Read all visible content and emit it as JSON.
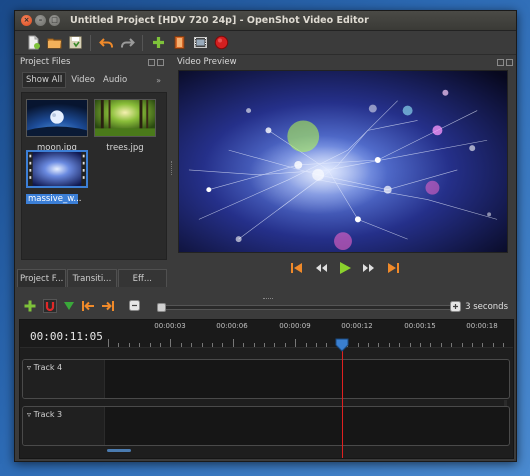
{
  "window": {
    "title": "Untitled Project [HDV 720 24p] - OpenShot Video Editor",
    "close_glyph": "×",
    "min_glyph": "–",
    "max_glyph": "□"
  },
  "toolbar": {
    "buttons": [
      "new-project",
      "open-project",
      "save-project",
      "undo",
      "redo",
      "import-files",
      "choose-profile",
      "fullscreen",
      "export-video"
    ]
  },
  "project_files": {
    "title": "Project Files",
    "filters": [
      "Show All",
      "Video",
      "Audio"
    ],
    "more_glyph": "»",
    "files": [
      {
        "name": "moon.jpg",
        "selected": false
      },
      {
        "name": "trees.jpg",
        "selected": false
      },
      {
        "name": "massive_w...",
        "selected": true
      }
    ],
    "bottom_tabs": [
      "Project F...",
      "Transiti...",
      "Eff..."
    ]
  },
  "video_preview": {
    "title": "Video Preview"
  },
  "timeline": {
    "zoom_label": "3 seconds",
    "timecode": "00:00:11:05",
    "ruler_labels": [
      "00:00:03",
      "00:00:06",
      "00:00:09",
      "00:00:12",
      "00:00:15",
      "00:00:18"
    ],
    "tracks": [
      {
        "name": "Track 4"
      },
      {
        "name": "Track 3"
      }
    ]
  },
  "colors": {
    "accent": "#3c7fd6",
    "playhead": "#e02020",
    "transport": "#f08a2a",
    "play": "#8bd22d"
  }
}
